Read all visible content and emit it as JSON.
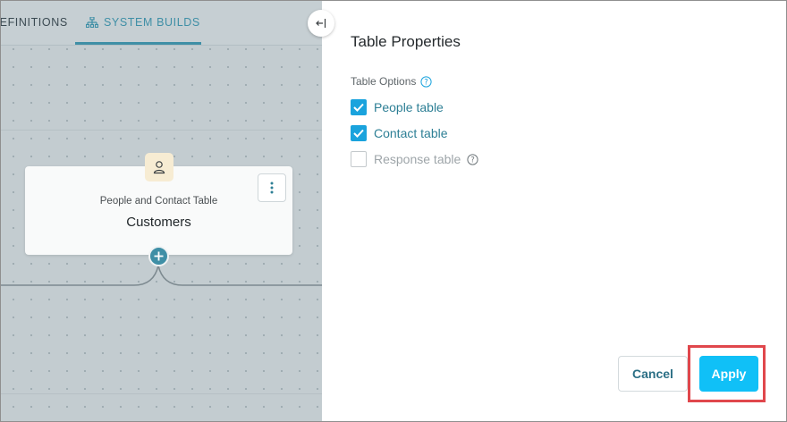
{
  "tabs": {
    "definitions_label": "DEFINITIONS",
    "system_builds_label": "SYSTEM BUILDS"
  },
  "node": {
    "subtitle": "People and Contact Table",
    "title": "Customers"
  },
  "panel": {
    "title": "Table Properties",
    "options_label": "Table Options",
    "options": [
      {
        "label": "People table",
        "checked": true
      },
      {
        "label": "Contact table",
        "checked": true
      },
      {
        "label": "Response table",
        "checked": false
      }
    ],
    "cancel_label": "Cancel",
    "apply_label": "Apply"
  },
  "colors": {
    "accent": "#3f8fa6",
    "checkbox": "#1aa3dd",
    "apply": "#10c0f7",
    "highlight": "#e0474c"
  }
}
